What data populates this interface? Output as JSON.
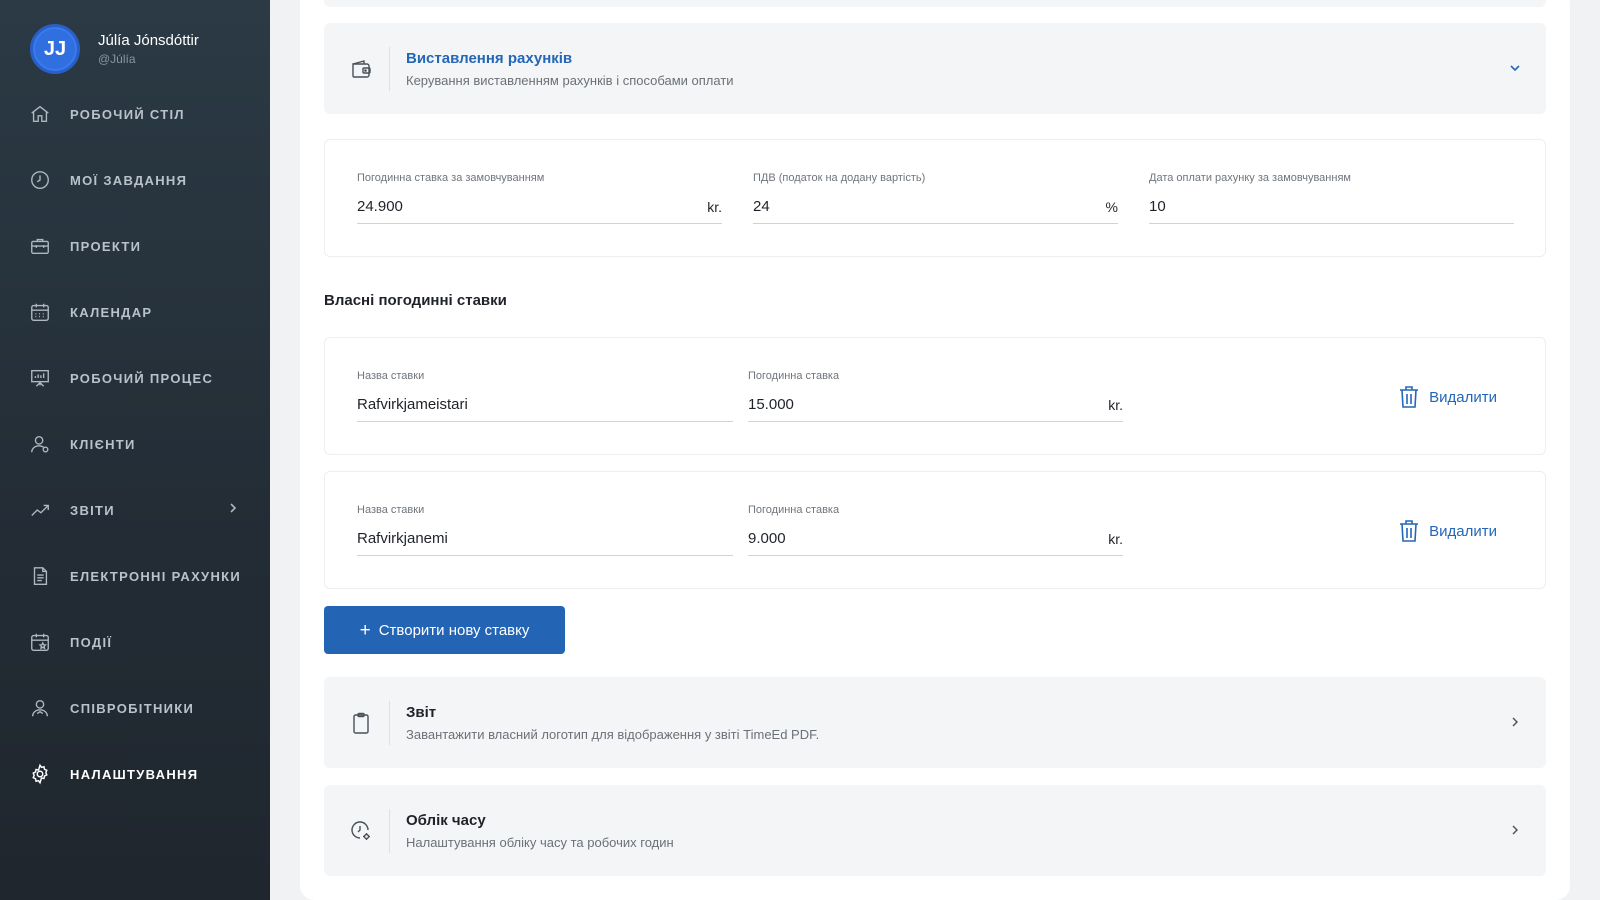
{
  "user": {
    "initials": "JJ",
    "name": "Júlía Jónsdóttir",
    "handle": "@Júlía"
  },
  "nav": [
    {
      "label": "РОБОЧИЙ СТІЛ",
      "icon": "home-icon"
    },
    {
      "label": "МОЇ ЗАВДАННЯ",
      "icon": "clock-icon"
    },
    {
      "label": "ПРОЕКТИ",
      "icon": "briefcase-icon"
    },
    {
      "label": "КАЛЕНДАР",
      "icon": "calendar-icon"
    },
    {
      "label": "РОБОЧИЙ ПРОЦЕС",
      "icon": "presentation-board-icon"
    },
    {
      "label": "КЛІЄНТИ",
      "icon": "user-icon"
    },
    {
      "label": "ЗВІТИ",
      "icon": "trend-chart-icon"
    },
    {
      "label": "ЕЛЕКТРОННІ РАХУНКИ",
      "icon": "document-icon"
    },
    {
      "label": "ПОДІЇ",
      "icon": "calendar-star-icon"
    },
    {
      "label": "СПІВРОБІТНИКИ",
      "icon": "users-icon"
    },
    {
      "label": "НАЛАШТУВАННЯ",
      "icon": "gear-icon"
    }
  ],
  "active_nav": "НАЛАШТУВАННЯ",
  "billing": {
    "title": "Виставлення рахунків",
    "subtitle": "Керування виставленням рахунків і способами оплати",
    "hourly_rate": {
      "label": "Погодинна ставка за замовчуванням",
      "value": "24.900",
      "unit": "kr."
    },
    "vat": {
      "label": "ПДВ (податок на додану вартість)",
      "value": "24",
      "unit": "%"
    },
    "due_date": {
      "label": "Дата оплати рахунку за замовчуванням",
      "value": "10"
    }
  },
  "custom_rates": {
    "title": "Власні погодинні ставки",
    "name_label": "Назва ставки",
    "rate_label": "Погодинна ставка",
    "unit": "kr.",
    "delete_label": "Видалити",
    "items": [
      {
        "name": "Rafvirkjameistari",
        "rate": "15.000"
      },
      {
        "name": "Rafvirkjanemi",
        "rate": "9.000"
      }
    ]
  },
  "create_button": {
    "plus": "+",
    "label": "Створити нову ставку"
  },
  "report": {
    "title": "Звіт",
    "subtitle": "Завантажити власний логотип для відображення у звіті TimeEd PDF."
  },
  "timekeeping": {
    "title": "Облік часу",
    "subtitle": "Налаштування обліку часу та робочих годин"
  },
  "colors": {
    "accent": "#2467b8",
    "button": "#2464b4",
    "sidebar": "#263340"
  }
}
